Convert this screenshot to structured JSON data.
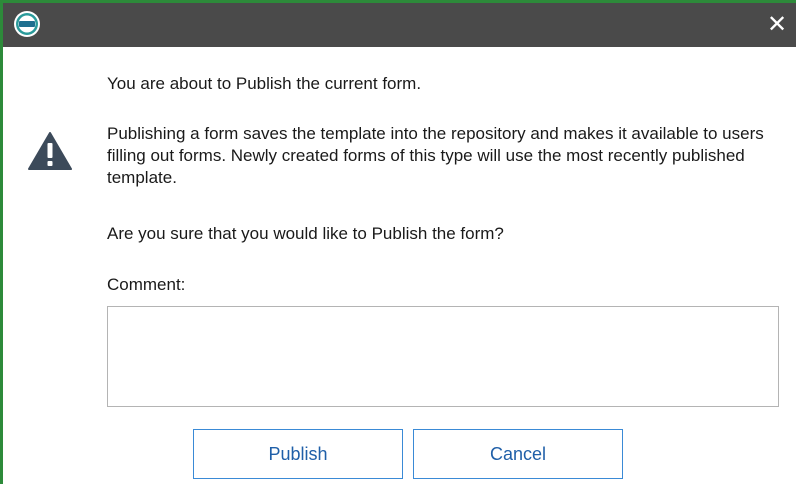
{
  "dialog": {
    "app_icon": "app-logo-icon",
    "close_glyph": "✕",
    "warning_icon": "warning-icon",
    "intro": "You are about to Publish the current form.",
    "body": "Publishing a form saves the template into the repository and makes it available to users filling out forms.  Newly created forms of this type will use the most recently published template.",
    "question": "Are you sure that you would like to Publish the form?",
    "comment_label": "Comment:",
    "comment_value": "",
    "publish_label": "Publish",
    "cancel_label": "Cancel"
  },
  "colors": {
    "titlebar": "#4a4a4a",
    "accent_border": "#2d8a3a",
    "button_border": "#3a8ad6",
    "button_text": "#1f5fa8",
    "warning_icon": "#3c4a5a"
  }
}
